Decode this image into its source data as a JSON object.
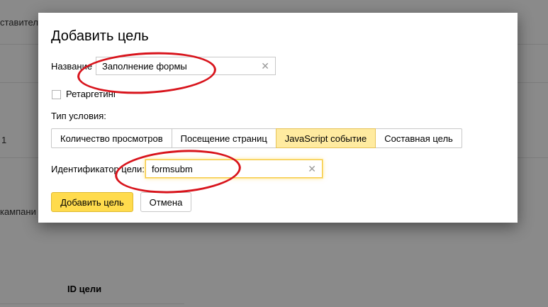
{
  "background": {
    "partial_header": "ставител",
    "partial_value": "1",
    "partial_campaign": "кампани",
    "id_column_header": "ID цели"
  },
  "modal": {
    "title": "Добавить цель",
    "name_label": "Название",
    "name_value": "Заполнение формы",
    "retargeting_label": "Ретаргетинг",
    "condition_type_label": "Тип условия:",
    "condition_tabs": [
      {
        "label": "Количество просмотров",
        "active": false
      },
      {
        "label": "Посещение страниц",
        "active": false
      },
      {
        "label": "JavaScript событие",
        "active": true
      },
      {
        "label": "Составная цель",
        "active": false
      }
    ],
    "identifier_label": "Идентификатор цели:",
    "identifier_value": "formsubm",
    "clear_glyph": "✕",
    "add_button": "Добавить цель",
    "cancel_button": "Отмена"
  },
  "colors": {
    "primary_button": "#ffdb4d",
    "active_tab": "#ffeba0",
    "annotation_ellipse": "#d8141c"
  }
}
